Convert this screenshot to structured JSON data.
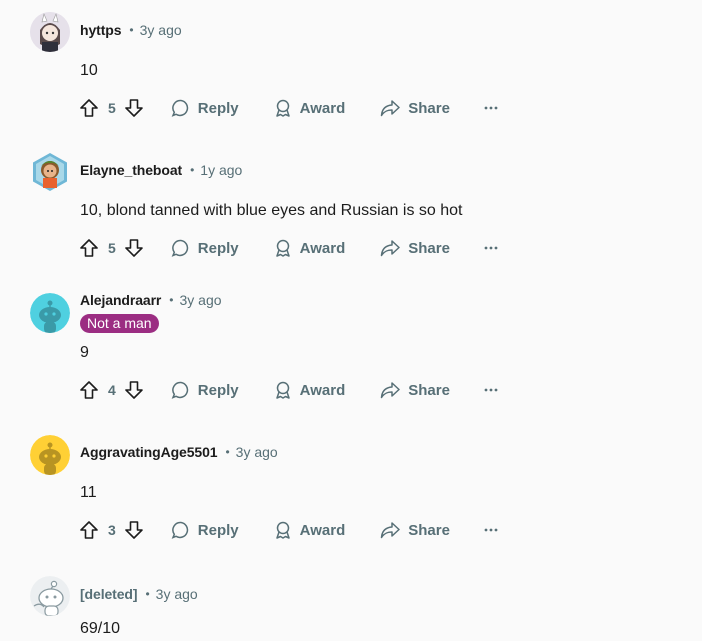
{
  "actions": {
    "reply": "Reply",
    "award": "Award",
    "share": "Share"
  },
  "comments": [
    {
      "username": "hyttps",
      "time": "3y ago",
      "body": "10",
      "votes": "5",
      "avatar": "anime-avatar"
    },
    {
      "username": "Elayne_theboat",
      "time": "1y ago",
      "body": "10, blond tanned with blue eyes and Russian is so hot",
      "votes": "5",
      "avatar": "hexagon-nft-avatar"
    },
    {
      "username": "Alejandraarr",
      "time": "3y ago",
      "flair": "Not a man",
      "flair_color": "#9b2d82",
      "body": "9",
      "votes": "4",
      "avatar": "teal-snoo-avatar",
      "avatar_color": "#4fd0e0"
    },
    {
      "username": "AggravatingAge5501",
      "time": "3y ago",
      "body": "11",
      "votes": "3",
      "avatar": "yellow-snoo-avatar",
      "avatar_color": "#ffd035"
    },
    {
      "username": "[deleted]",
      "time": "3y ago",
      "body": "69/10",
      "avatar": "deleted-snoo-avatar"
    }
  ]
}
